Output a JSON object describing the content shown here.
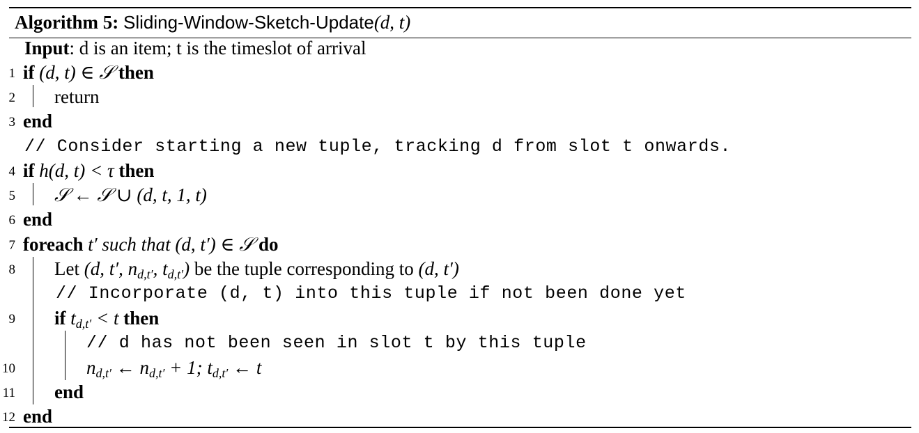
{
  "algorithm": {
    "caption_label": "Algorithm 5:",
    "caption_name": "Sliding-Window-Sketch-Update",
    "caption_args": "(d, t)",
    "input_label": "Input",
    "input_text": ": d is an item; t is the timeslot of arrival",
    "lines": [
      {
        "num": "1",
        "kw1": "if",
        "expr": "(d, t) ∈ 𝒮",
        "kw2": "then"
      },
      {
        "num": "2",
        "text": "return"
      },
      {
        "num": "3",
        "kw1": "end"
      },
      {
        "comment": "// Consider starting a new tuple, tracking d from slot t onwards."
      },
      {
        "num": "4",
        "kw1": "if",
        "expr": "h(d, t) < τ",
        "kw2": "then"
      },
      {
        "num": "5",
        "expr": "𝒮 ← 𝒮 ∪ (d, t, 1, t)"
      },
      {
        "num": "6",
        "kw1": "end"
      },
      {
        "num": "7",
        "kw1": "foreach",
        "expr1": "t′",
        "phrase": "such that",
        "expr2": "(d, t′) ∈ 𝒮",
        "kw2": "do"
      },
      {
        "num": "8",
        "text_a": "Let",
        "expr_a": "(d, t′, n",
        "sub_a": "d,t′",
        "expr_b": ", t",
        "sub_b": "d,t′",
        "expr_c": ")",
        "text_b": "be the tuple corresponding to",
        "expr_d": "(d, t′)"
      },
      {
        "comment": "// Incorporate (d, t) into this tuple if not been done yet"
      },
      {
        "num": "9",
        "kw1": "if",
        "expr_a": "t",
        "sub_a": "d,t′",
        "expr_b": "< t",
        "kw2": "then"
      },
      {
        "comment": "// d has not been seen in slot t by this tuple"
      },
      {
        "num": "10",
        "expr_a": "n",
        "sub_a": "d,t′",
        "expr_b": "← n",
        "sub_b": "d,t′",
        "expr_c": "+ 1; t",
        "sub_c": "d,t′",
        "expr_d": "← t"
      },
      {
        "num": "11",
        "kw1": "end"
      },
      {
        "num": "12",
        "kw1": "end"
      }
    ]
  }
}
